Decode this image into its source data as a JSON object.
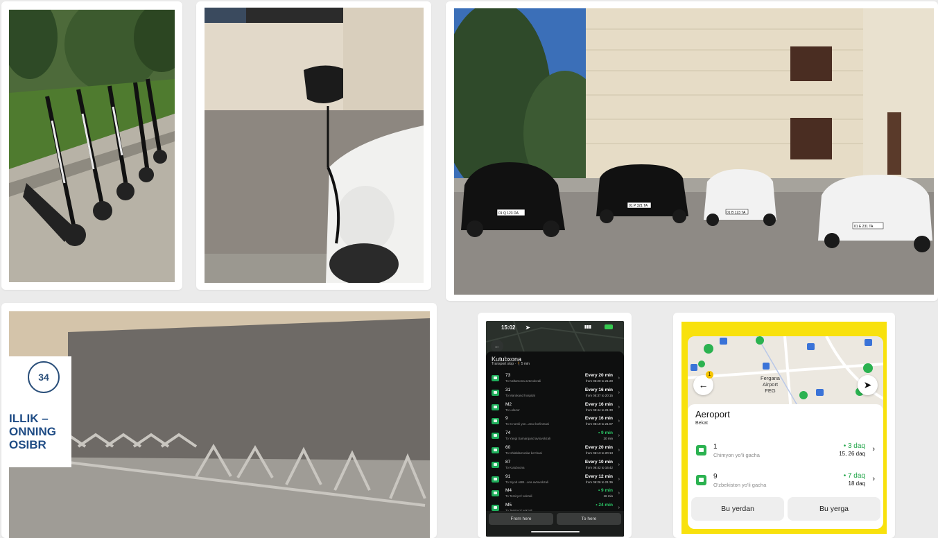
{
  "phone_dark": {
    "time": "15:02",
    "stop_title": "Kutubxona",
    "stop_subtitle": "Transport stop · 🚶5 min",
    "routes": [
      {
        "num": "73",
        "dest": "To Kaftarsona avtovokzali",
        "freq": "Every 20 min",
        "hours": "from 06:20 to 21:20",
        "live": false
      },
      {
        "num": "31",
        "dest": "To Marokand hospital",
        "freq": "Every 16 min",
        "hours": "from 05:37 to 20:15",
        "live": false
      },
      {
        "num": "M2",
        "dest": "To Lolazor",
        "freq": "Every 16 min",
        "hours": "from 05:44 to 21:30",
        "live": false
      },
      {
        "num": "9",
        "dest": "To S nomli yon...aruv bo'linmasi",
        "freq": "Every 16 min",
        "hours": "from 06:19 to 21:07",
        "live": false
      },
      {
        "num": "74",
        "dest": "To Yangi Samarqand avtovokzali",
        "freq": "• 9 min",
        "hours": "20 min",
        "live": true
      },
      {
        "num": "60",
        "dest": "To Ishlablarnonlar ko'chasi",
        "freq": "Every 20 min",
        "hours": "from 06:13 to 20:13",
        "live": false
      },
      {
        "num": "87",
        "dest": "To Kutubxona",
        "freq": "Every 10 min",
        "hours": "from 06:42 to 16:42",
        "live": false
      },
      {
        "num": "91",
        "dest": "To Siyob ABB...ona avtovokzali",
        "freq": "Every 12 min",
        "hours": "from 06:26 to 21:36",
        "live": false
      },
      {
        "num": "M4",
        "dest": "To Temiryo'l vokzali",
        "freq": "• 9 min",
        "hours": "16 min",
        "live": true
      },
      {
        "num": "M5",
        "dest": "To Temiryo'l vokzali",
        "freq": "• 24 min",
        "hours": "",
        "live": true
      }
    ],
    "from_here": "From here",
    "to_here": "To here"
  },
  "phone_yellow": {
    "map_label_1": "Fergana",
    "map_label_2": "Airport",
    "map_label_3": "FEG",
    "stop_title": "Aeroport",
    "stop_subtitle": "Bekat",
    "routes": [
      {
        "num": "1",
        "dest": "Chimyon yo'li gacha",
        "eta": "• 3 daq",
        "next": "15, 26 daq"
      },
      {
        "num": "9",
        "dest": "O'zbekiston yo'li gacha",
        "eta": "• 7 daq",
        "next": "18 daq"
      }
    ],
    "btn_from": "Bu yerdan",
    "btn_to": "Bu yerga"
  },
  "banner": {
    "line1": "ILLIK –",
    "line2": "ONNING",
    "line3": "OSIBR",
    "logo": "34"
  },
  "plates": [
    "01 Q 123 DA",
    "01 P 321 TA",
    "01 B 123 TA",
    "01 E 231 TA"
  ]
}
